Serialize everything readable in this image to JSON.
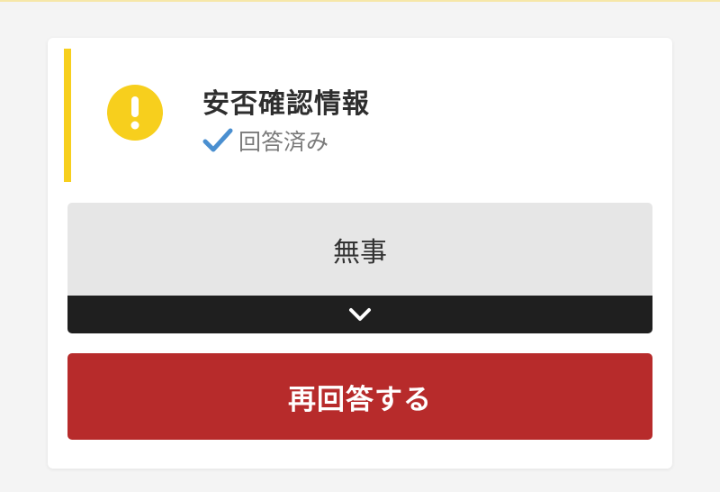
{
  "header": {
    "accent_color": "#f7cf1d",
    "icon": "exclamation-circle-icon",
    "title": "安否確認情報",
    "status_icon": "checkmark-icon",
    "status_text": "回答済み",
    "status_icon_color": "#4a8fd0"
  },
  "answer_select": {
    "selected_value": "無事",
    "toggle_icon": "chevron-down-icon"
  },
  "actions": {
    "reanswer_label": "再回答する",
    "reanswer_color": "#b72b2b"
  }
}
